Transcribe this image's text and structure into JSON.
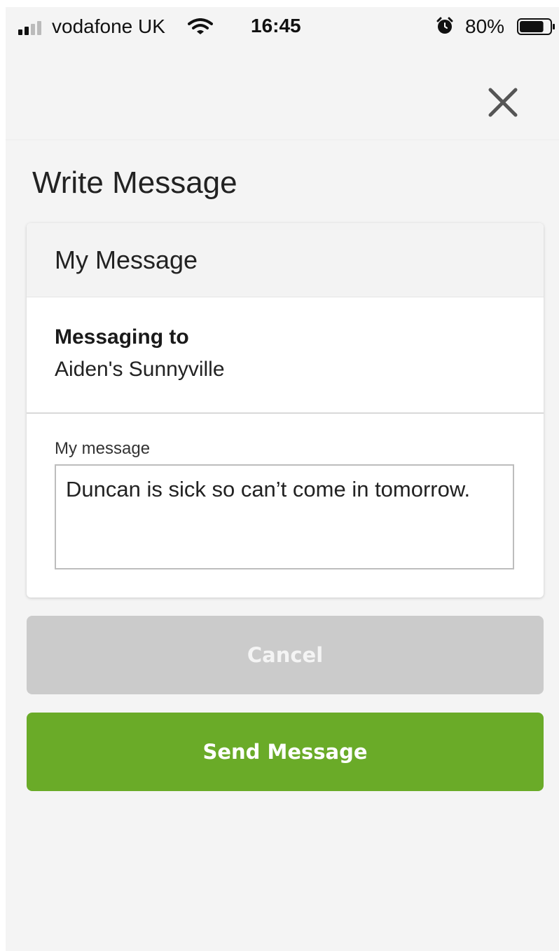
{
  "status_bar": {
    "carrier": "vodafone UK",
    "time": "16:45",
    "battery_percent": "80%",
    "battery_level": 0.8,
    "icons": [
      "signal-icon",
      "wifi-icon",
      "alarm-icon",
      "battery-icon"
    ]
  },
  "header": {
    "close_icon": "close-icon"
  },
  "page": {
    "title": "Write Message"
  },
  "card": {
    "title": "My Message",
    "recipient_label": "Messaging to",
    "recipient_name": "Aiden's Sunnyville",
    "message_label": "My message",
    "message_value": "Duncan is sick so can’t come in tomorrow."
  },
  "actions": {
    "cancel_label": "Cancel",
    "send_label": "Send Message"
  },
  "colors": {
    "send_button": "#6aab28",
    "cancel_button": "#cbcbcb",
    "background": "#f4f4f4"
  }
}
